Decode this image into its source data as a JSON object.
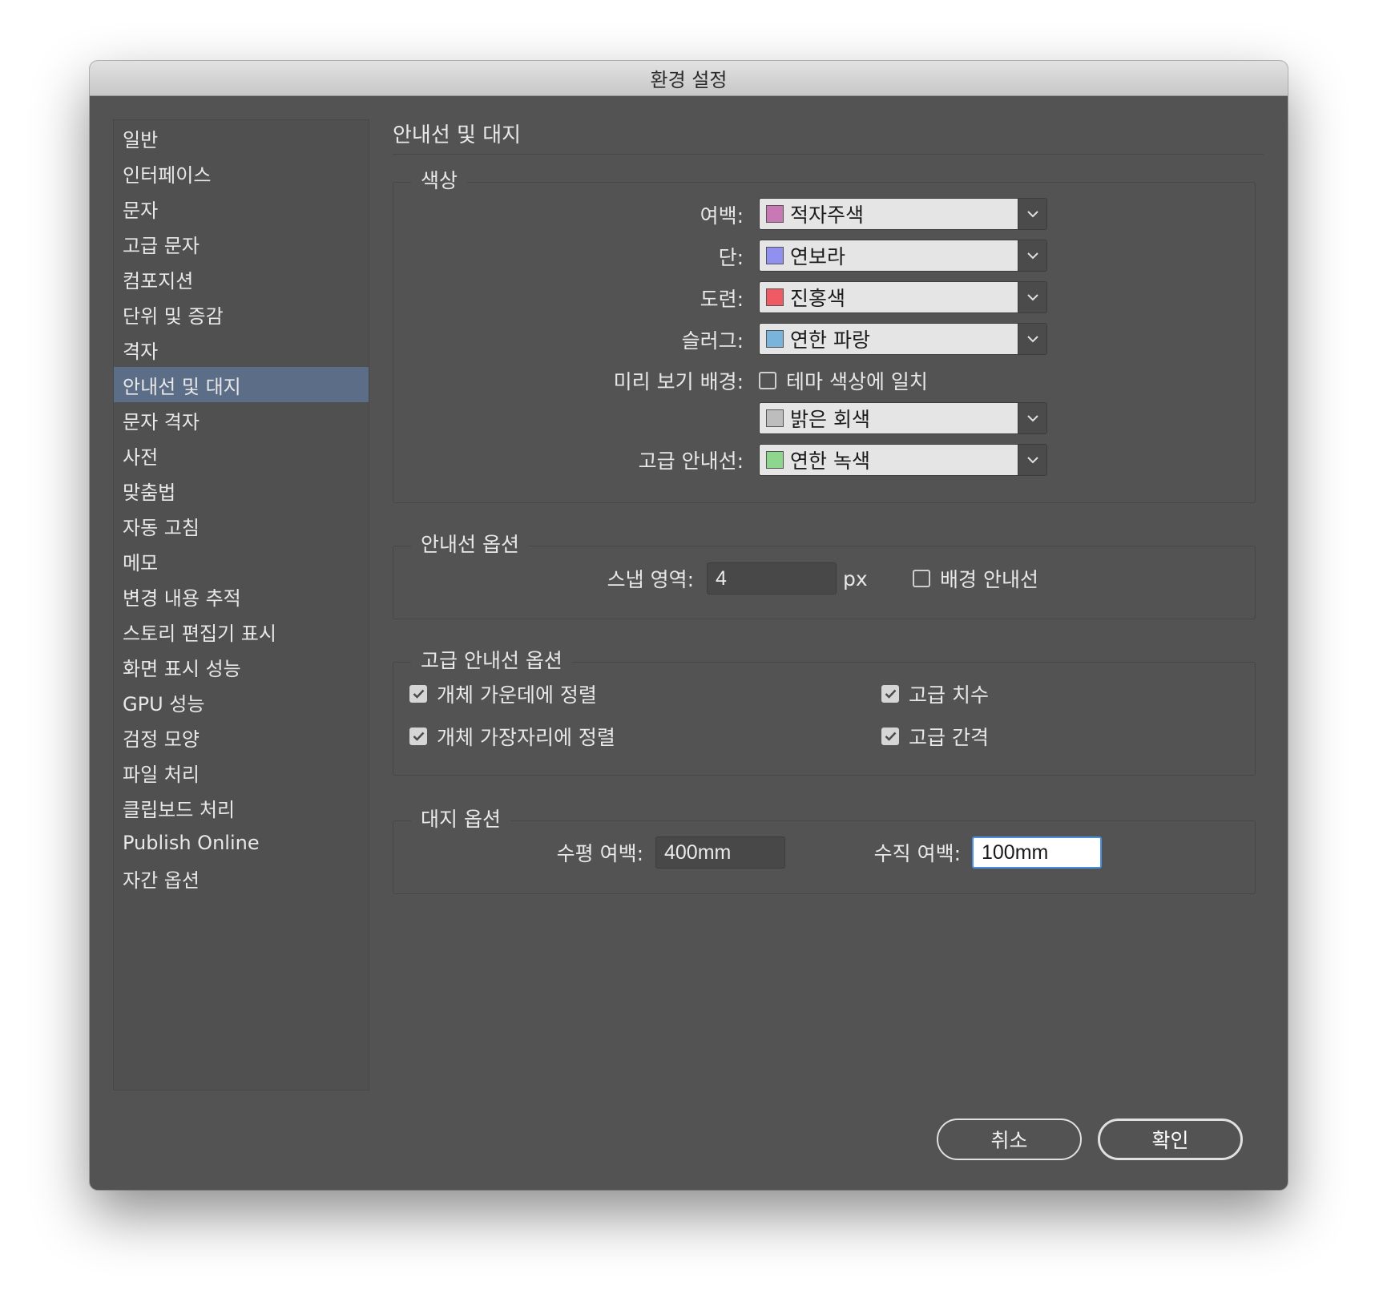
{
  "window": {
    "title": "환경 설정"
  },
  "sidebar": {
    "items": [
      {
        "label": "일반"
      },
      {
        "label": "인터페이스"
      },
      {
        "label": "문자"
      },
      {
        "label": "고급 문자"
      },
      {
        "label": "컴포지션"
      },
      {
        "label": "단위 및 증감"
      },
      {
        "label": "격자"
      },
      {
        "label": "안내선 및 대지",
        "selected": true
      },
      {
        "label": "문자 격자"
      },
      {
        "label": "사전"
      },
      {
        "label": "맞춤법"
      },
      {
        "label": "자동 고침"
      },
      {
        "label": "메모"
      },
      {
        "label": "변경 내용 추적"
      },
      {
        "label": "스토리 편집기 표시"
      },
      {
        "label": "화면 표시 성능"
      },
      {
        "label": "GPU 성능"
      },
      {
        "label": "검정 모양"
      },
      {
        "label": "파일 처리"
      },
      {
        "label": "클립보드 처리"
      },
      {
        "label": "Publish Online"
      },
      {
        "label": "자간 옵션"
      }
    ]
  },
  "main": {
    "title": "안내선 및 대지",
    "colors": {
      "label": "색상",
      "margins": {
        "label": "여백:",
        "value": "적자주색",
        "swatch": "#c878b4"
      },
      "columns": {
        "label": "단:",
        "value": "연보라",
        "swatch": "#9090f0"
      },
      "bleed": {
        "label": "도련:",
        "value": "진홍색",
        "swatch": "#f05a64"
      },
      "slug": {
        "label": "슬러그:",
        "value": "연한 파랑",
        "swatch": "#78b4dc"
      },
      "preview_bg": {
        "label": "미리 보기 배경:",
        "checkbox_label": "테마 색상에 일치",
        "checked": false,
        "value": "밝은 회색",
        "swatch": "#bdbdbd"
      },
      "smart_guides": {
        "label": "고급 안내선:",
        "value": "연한 녹색",
        "swatch": "#8ed68e"
      }
    },
    "guide_options": {
      "label": "안내선 옵션",
      "snap_label": "스냅 영역:",
      "snap_value": "4",
      "snap_unit": "px",
      "guides_in_back": {
        "label": "배경 안내선",
        "checked": false
      }
    },
    "smart_guide_options": {
      "label": "고급 안내선 옵션",
      "align_center": {
        "label": "개체 가운데에 정렬",
        "checked": true
      },
      "align_edges": {
        "label": "개체 가장자리에 정렬",
        "checked": true
      },
      "smart_dimensions": {
        "label": "고급 치수",
        "checked": true
      },
      "smart_spacing": {
        "label": "고급 간격",
        "checked": true
      }
    },
    "pasteboard_options": {
      "label": "대지 옵션",
      "horizontal_label": "수평 여백:",
      "horizontal_value": "400mm",
      "vertical_label": "수직 여백:",
      "vertical_value": "100mm"
    }
  },
  "footer": {
    "cancel": "취소",
    "ok": "확인"
  }
}
